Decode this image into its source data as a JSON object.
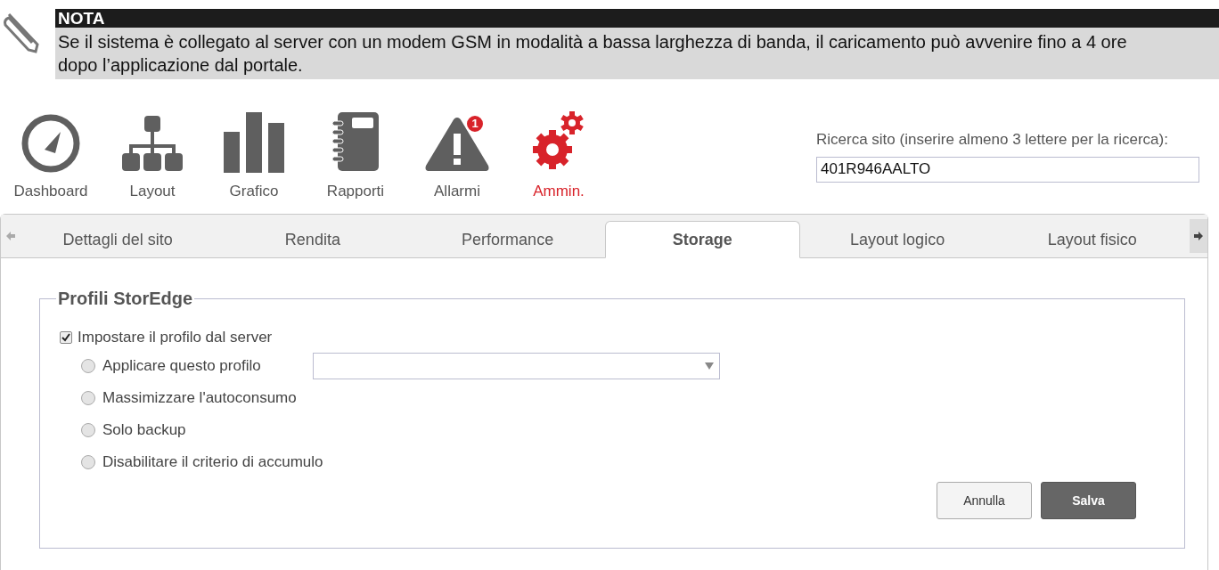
{
  "note": {
    "title": "NOTA",
    "text": "Se il sistema è collegato al server con un modem GSM in modalità a bassa larghezza di banda, il caricamento può avvenire fino a 4 ore dopo l’applicazione dal portale."
  },
  "nav": [
    {
      "kind": "dashboard",
      "label": "Dashboard",
      "selected": false
    },
    {
      "kind": "layout",
      "label": "Layout",
      "selected": false
    },
    {
      "kind": "chart",
      "label": "Grafico",
      "selected": false
    },
    {
      "kind": "reports",
      "label": "Rapporti",
      "selected": false
    },
    {
      "kind": "alarms",
      "label": "Allarmi",
      "selected": false,
      "badge": "1"
    },
    {
      "kind": "admin",
      "label": "Ammin.",
      "selected": true
    }
  ],
  "search": {
    "label": "Ricerca sito (inserire almeno 3 lettere per la ricerca):",
    "value": "401R946AALTO"
  },
  "tabs": [
    {
      "label": "Dettagli del sito",
      "selected": false
    },
    {
      "label": "Rendita",
      "selected": false
    },
    {
      "label": "Performance",
      "selected": false
    },
    {
      "label": "Storage",
      "selected": true
    },
    {
      "label": "Layout logico",
      "selected": false
    },
    {
      "label": "Layout fisico",
      "selected": false
    }
  ],
  "profiles": {
    "title": "Profili StorEdge",
    "server": {
      "label": "Impostare il profilo dal server",
      "checked": true
    },
    "options": [
      {
        "label": "Applicare questo profilo",
        "selected": false,
        "kind": "with_select"
      },
      {
        "label": "Massimizzare l'autoconsumo",
        "selected": false,
        "kind": "plain"
      },
      {
        "label": "Solo backup",
        "selected": false,
        "kind": "plain"
      },
      {
        "label": "Disabilitare il criterio di accumulo",
        "selected": false,
        "kind": "plain"
      }
    ],
    "buttons": [
      {
        "label": "Annulla",
        "kind": "secondary"
      },
      {
        "label": "Salva",
        "kind": "primary"
      }
    ]
  }
}
